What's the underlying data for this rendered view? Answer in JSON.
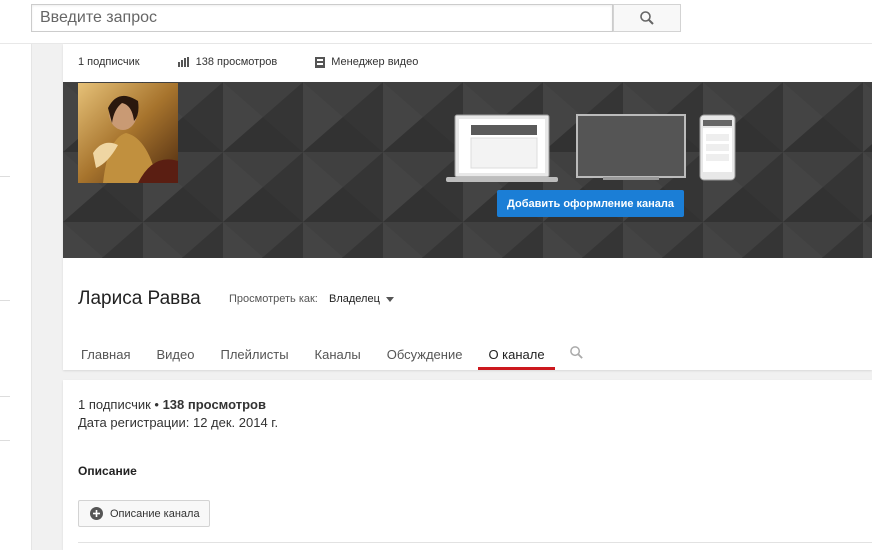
{
  "search": {
    "placeholder": "Введите запрос"
  },
  "stats": {
    "subscribers": "1 подписчик",
    "views": "138 просмотров",
    "video_manager": "Менеджер видео"
  },
  "banner": {
    "add_art_label": "Добавить оформление канала"
  },
  "channel": {
    "name": "Лариса Равва",
    "view_as_label": "Просмотреть как:",
    "view_as_value": "Владелец"
  },
  "tabs": [
    {
      "label": "Главная"
    },
    {
      "label": "Видео"
    },
    {
      "label": "Плейлисты"
    },
    {
      "label": "Каналы"
    },
    {
      "label": "Обсуждение"
    },
    {
      "label": "О канале"
    }
  ],
  "about": {
    "subscribers": "1 подписчик",
    "separator": " • ",
    "views": "138 просмотров",
    "registered": "Дата регистрации: 12 дек. 2014 г.",
    "description_title": "Описание",
    "description_button": "Описание канала"
  },
  "colors": {
    "accent_red": "#cc181e",
    "button_blue": "#1b7ed6"
  }
}
